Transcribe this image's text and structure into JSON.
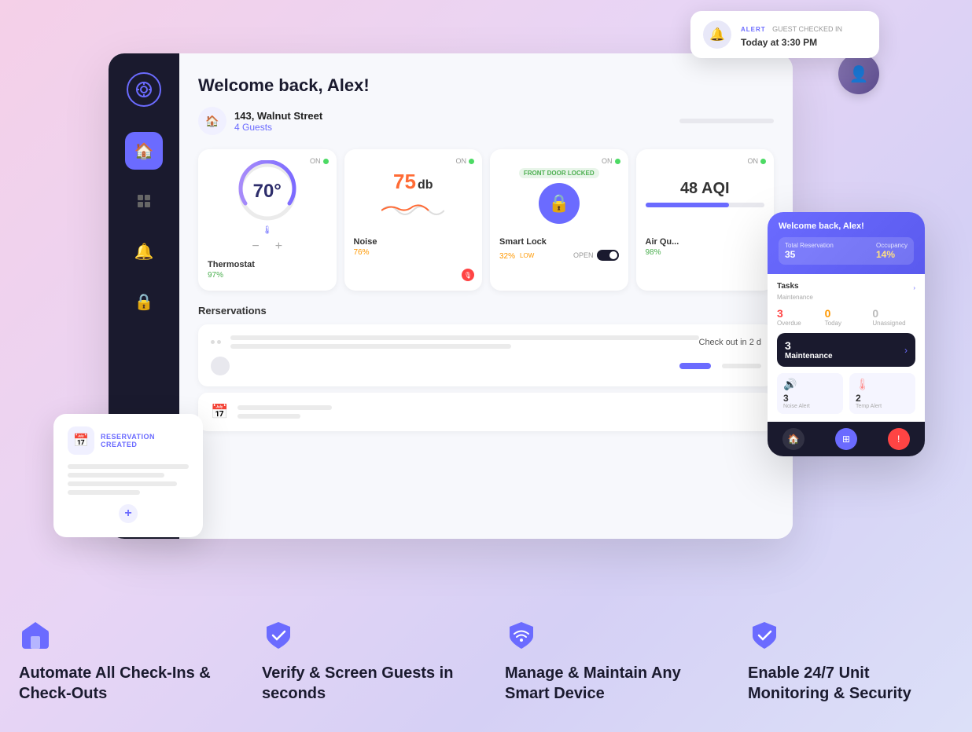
{
  "alert": {
    "label": "ALERT",
    "sub_label": "GUEST CHECKED IN",
    "message": "Today at 3:30 PM"
  },
  "dashboard": {
    "welcome": "Welcome back, Alex!",
    "address": "143, Walnut Street",
    "guests": "4 Guests"
  },
  "devices": [
    {
      "name": "Thermostat",
      "status": "ON",
      "percent": "97%",
      "percent_class": "green",
      "temp": "70°",
      "value": null
    },
    {
      "name": "Noise",
      "status": "ON",
      "percent": "76%",
      "percent_class": "orange",
      "temp": null,
      "value": "75 db"
    },
    {
      "name": "Smart Lock",
      "status": "ON",
      "percent": "32%",
      "percent_class": "orange",
      "badge": "FRONT DOOR LOCKED",
      "extra": "LOW",
      "open": "OPEN"
    },
    {
      "name": "Air Quality",
      "status": "ON",
      "percent": "98%",
      "percent_class": "green",
      "aqi": "48 AQI"
    }
  ],
  "reservations": {
    "title": "Rerservations",
    "checkout": "Check out in 2 d"
  },
  "reservation_popup": {
    "badge": "RESERVATION CREATED"
  },
  "mobile_app": {
    "header_title": "Welcome back, Alex!",
    "reservation_label": "Total Reservation",
    "reservation_value": "35",
    "occupancy_label": "Occupancy",
    "occupancy_value": "14%",
    "tasks_title": "Tasks",
    "tasks_sub": "Maintenance",
    "overdue_label": "Overdue",
    "overdue_value": "3",
    "today_label": "Today",
    "today_value": "0",
    "unassigned_label": "Unassigned",
    "unassigned_value": "0",
    "maintenance_num": "3",
    "noise_alert_num": "3",
    "noise_alert_label": "Noise Alert",
    "temp_alert_num": "2",
    "temp_alert_label": "Temp Alert"
  },
  "features": [
    {
      "icon": "🏠",
      "title": "Automate All Check-Ins & Check-Outs"
    },
    {
      "icon": "✔",
      "title": "Verify & Screen Guests in seconds"
    },
    {
      "icon": "📶",
      "title": "Manage & Maintain Any Smart Device"
    },
    {
      "icon": "✔",
      "title": "Enable 24/7 Unit Monitoring & Security"
    }
  ],
  "colors": {
    "purple": "#6b6bff",
    "dark": "#1a1a2e",
    "green": "#4caf50",
    "orange": "#ff9800",
    "red": "#ff4444"
  }
}
